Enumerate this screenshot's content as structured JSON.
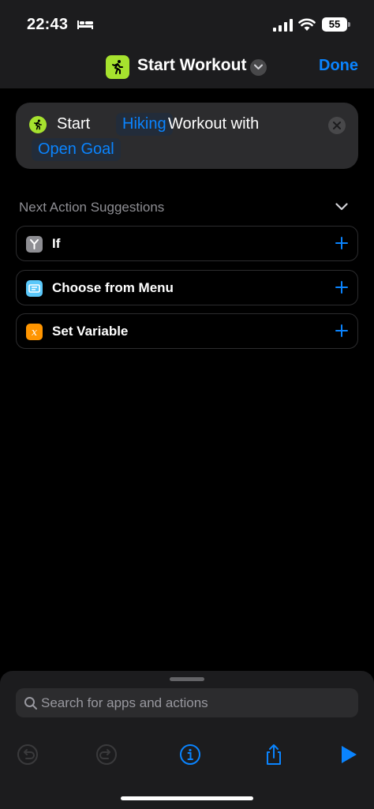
{
  "status_bar": {
    "time": "22:43",
    "battery": "55"
  },
  "nav": {
    "title": "Start Workout",
    "done_label": "Done"
  },
  "action": {
    "word_start": "Start",
    "workout_type": "Hiking",
    "word_workout_with": "Workout with",
    "goal": "Open Goal"
  },
  "suggestions": {
    "header": "Next Action Suggestions",
    "items": [
      {
        "label": "If",
        "icon": "if-icon",
        "color": "#8e8e93"
      },
      {
        "label": "Choose from Menu",
        "icon": "menu-icon",
        "color": "#5ac8fa"
      },
      {
        "label": "Set Variable",
        "icon": "variable-icon",
        "color": "#ff9500"
      }
    ]
  },
  "search": {
    "placeholder": "Search for apps and actions"
  },
  "colors": {
    "accent": "#0a84ff",
    "workout_green": "#a6e22e"
  }
}
